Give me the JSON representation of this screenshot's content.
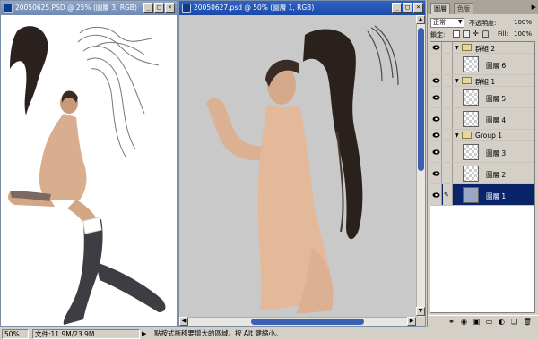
{
  "left_window": {
    "title": "20050625.PSD @ 25% (圖層 3, RGB)"
  },
  "main_window": {
    "title": "20050627.psd @ 50% (圖層 1, RGB)"
  },
  "window_controls": {
    "minimize": "_",
    "maximize": "□",
    "close": "×"
  },
  "layers_panel": {
    "tabs": [
      "圖層",
      "色版"
    ],
    "blend_mode": "正常",
    "opacity_label": "不透明度:",
    "opacity_value": "100%",
    "lock_label": "鎖定:",
    "fill_label": "Fill:",
    "fill_value": "100%",
    "rows": [
      {
        "type": "group",
        "name": "群組 2",
        "visible": true
      },
      {
        "type": "layer",
        "name": "圖層 6",
        "visible": false
      },
      {
        "type": "group",
        "name": "群組 1",
        "visible": true
      },
      {
        "type": "layer",
        "name": "圖層 5",
        "visible": true
      },
      {
        "type": "layer",
        "name": "圖層 4",
        "visible": true
      },
      {
        "type": "group",
        "name": "Group 1",
        "visible": true
      },
      {
        "type": "layer",
        "name": "圖層 3",
        "visible": true
      },
      {
        "type": "layer",
        "name": "圖層 2",
        "visible": true
      },
      {
        "type": "layer",
        "name": "圖層 1",
        "visible": true,
        "selected": true
      }
    ],
    "bottom_icons": [
      "link-icon",
      "layer-style-icon",
      "mask-icon",
      "new-set-icon",
      "adjustment-icon",
      "new-layer-icon",
      "trash-icon"
    ]
  },
  "status_bar": {
    "zoom": "50%",
    "doc_info": "文件:11.9M/23.9M",
    "hint": "點按式拖移要增大的區域。按 Alt 鍵縮小。"
  },
  "colors": {
    "active_title": "#1b4aa7",
    "inactive_title": "#6f89b3",
    "selection": "#0a246a",
    "canvas_gray": "#c9c9c9"
  }
}
